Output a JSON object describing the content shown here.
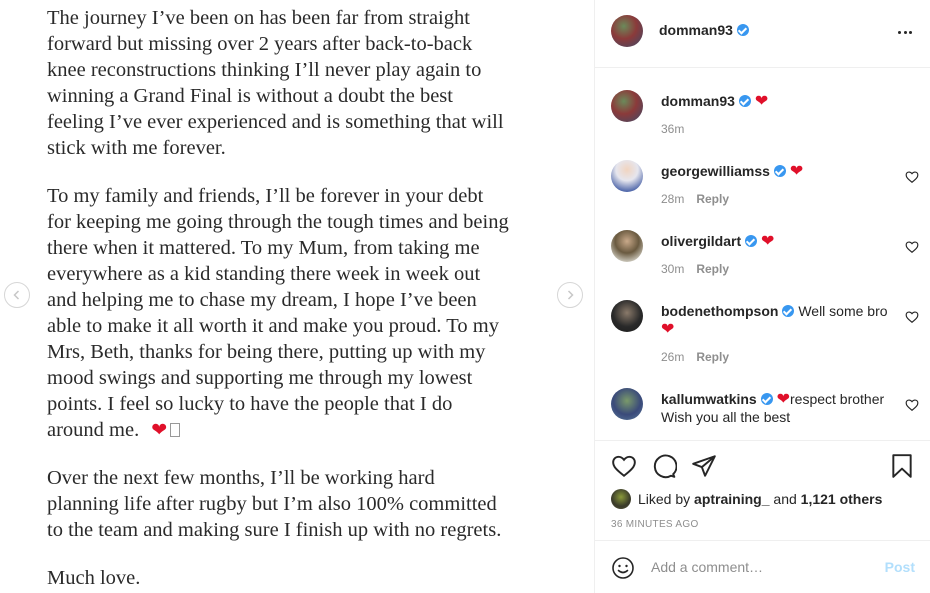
{
  "post_image": {
    "paragraphs": [
      "The journey I’ve been on has been far from straight\nforward but missing over 2 years after back-to-back\nknee reconstructions thinking I’ll never play again to\nwinning a Grand Final is without a doubt the best\nfeeling I’ve ever experienced and is something that will\nstick with me forever.",
      "To my family and friends, I’ll be forever in your debt\nfor keeping me going through the tough times and being\nthere when it mattered. To my Mum, from taking me\neverywhere as a kid standing there week in week out\nand helping me to chase my dream, I hope I’ve been\nable to make it all worth it and make you proud. To my\nMrs, Beth, thanks for being there, putting up with my\nmood swings and supporting me through my lowest\npoints. I feel so lucky to have the people that I do\naround me.",
      "Over the next few months, I’ll be working hard\nplanning life after rugby but I’m also 100% committed\nto the team and making sure I finish up with no regrets.",
      "Much love."
    ],
    "heart": "❤"
  },
  "header": {
    "username": "domman93"
  },
  "comments": [
    {
      "username": "domman93",
      "text": "",
      "emoji": "❤",
      "time": "36m",
      "reply": ""
    },
    {
      "username": "georgewilliamss",
      "text": "",
      "emoji": "❤",
      "time": "28m",
      "reply": "Reply"
    },
    {
      "username": "olivergildart",
      "text": "",
      "emoji": "❤",
      "time": "30m",
      "reply": "Reply"
    },
    {
      "username": "bodenethompson",
      "text": "Well some bro",
      "emoji": "❤",
      "time": "26m",
      "reply": "Reply"
    },
    {
      "username": "kallumwatkins",
      "text": "respect brother",
      "text2": "Wish you all the best",
      "emoji": "❤",
      "time": "",
      "reply": ""
    }
  ],
  "likes": {
    "prefix": "Liked by",
    "user": "aptraining_",
    "conjunction": "and",
    "others": "1,121 others"
  },
  "timestamp": "36 MINUTES AGO",
  "comment_box": {
    "placeholder": "Add a comment…",
    "post_label": "Post"
  },
  "colors": {
    "accent": "#3897f0",
    "heart": "#e0102a",
    "post_disabled": "#b2dffc"
  }
}
